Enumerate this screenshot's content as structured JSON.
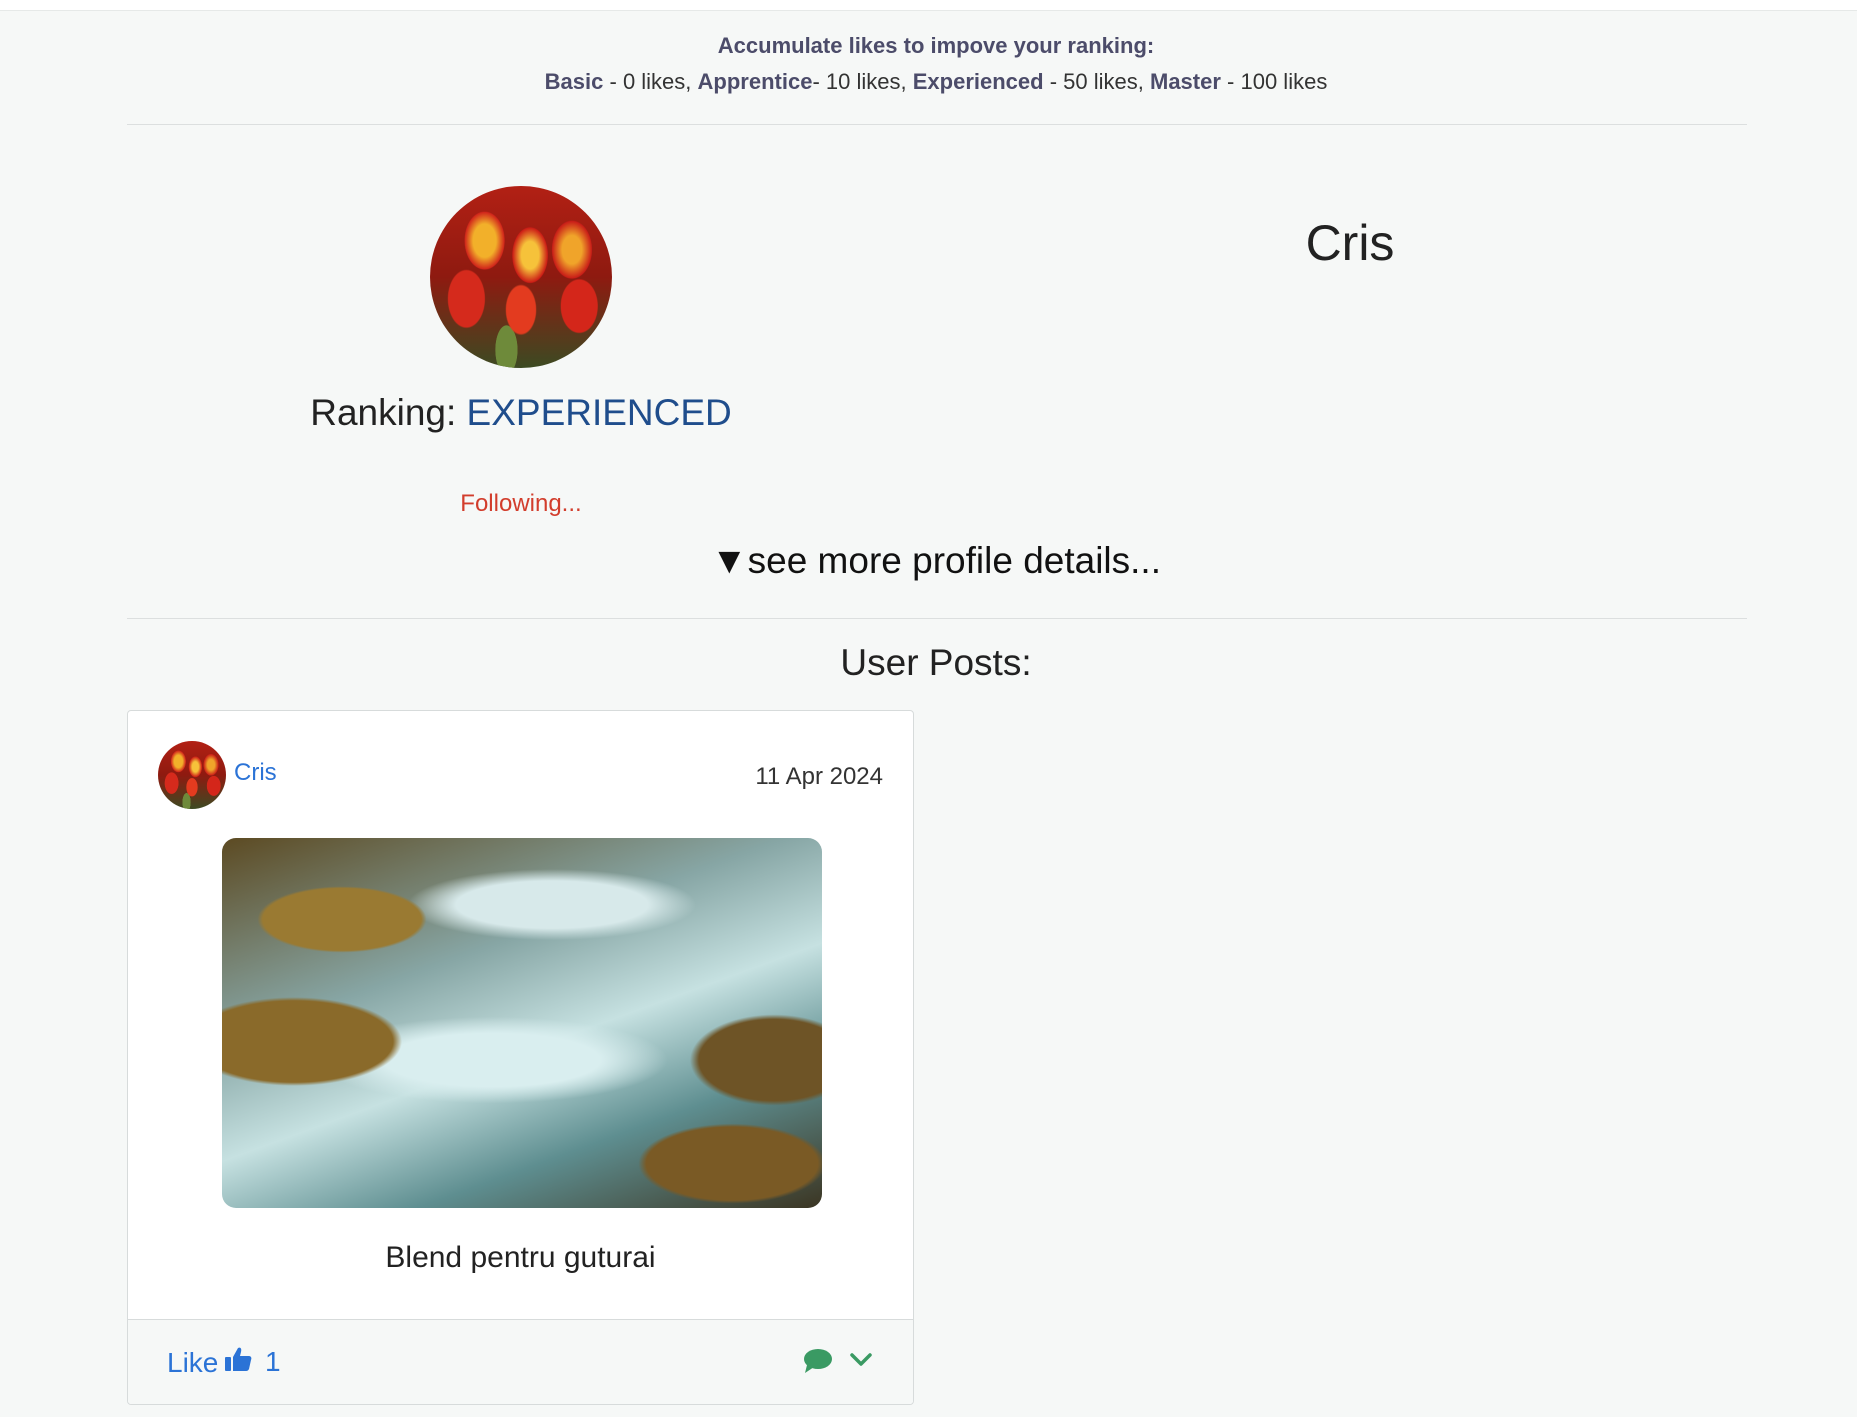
{
  "ranking_info": {
    "heading": "Accumulate likes to impove your ranking:",
    "levels": [
      {
        "name": "Basic",
        "requirement": "- 0 likes,"
      },
      {
        "name": "Apprentice",
        "requirement": "- 10 likes,"
      },
      {
        "name": "Experienced",
        "requirement": "- 50 likes,"
      },
      {
        "name": "Master",
        "requirement": "- 100 likes"
      }
    ]
  },
  "profile": {
    "username": "Cris",
    "ranking_label": "Ranking:",
    "ranking_value": "EXPERIENCED",
    "follow_status": "Following...",
    "see_more": "▼see more profile details..."
  },
  "posts_section": {
    "title": "User Posts:",
    "posts": [
      {
        "author": "Cris",
        "date": "11 Apr 2024",
        "title": "Blend pentru guturai",
        "like_label": "Like",
        "like_count": "1"
      }
    ]
  },
  "colors": {
    "background": "#f6f8f7",
    "link_blue": "#2b73d6",
    "ranking_blue": "#1f4d8c",
    "follow_red": "#d23d2c",
    "comment_green": "#3a9a63"
  }
}
